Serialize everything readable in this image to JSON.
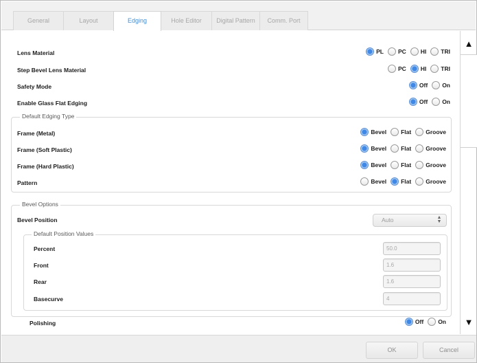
{
  "tabs": [
    {
      "label": "General"
    },
    {
      "label": "Layout"
    },
    {
      "label": "Edging"
    },
    {
      "label": "Hole Editor"
    },
    {
      "label": "Digital Pattern"
    },
    {
      "label": "Comm. Port"
    }
  ],
  "active_tab": "Edging",
  "settings": {
    "lens_material": {
      "label": "Lens Material",
      "options": [
        "PL",
        "PC",
        "HI",
        "TRI"
      ],
      "selected": "PL"
    },
    "step_bevel": {
      "label": "Step Bevel Lens Material",
      "options": [
        "PC",
        "HI",
        "TRI"
      ],
      "selected": "HI"
    },
    "safety_mode": {
      "label": "Safety Mode",
      "options": [
        "Off",
        "On"
      ],
      "selected": "Off"
    },
    "glass_flat": {
      "label": "Enable Glass Flat Edging",
      "options": [
        "Off",
        "On"
      ],
      "selected": "Off"
    }
  },
  "default_edging": {
    "legend": "Default Edging Type",
    "options": [
      "Bevel",
      "Flat",
      "Groove"
    ],
    "rows": [
      {
        "label": "Frame (Metal)",
        "selected": "Bevel"
      },
      {
        "label": "Frame (Soft Plastic)",
        "selected": "Bevel"
      },
      {
        "label": "Frame (Hard Plastic)",
        "selected": "Bevel"
      },
      {
        "label": "Pattern",
        "selected": "Flat"
      }
    ]
  },
  "bevel_options": {
    "legend": "Bevel Options",
    "bevel_position": {
      "label": "Bevel Position",
      "value": "Auto"
    },
    "default_position": {
      "legend": "Default Position Values",
      "fields": [
        {
          "label": "Percent",
          "value": "50.0"
        },
        {
          "label": "Front",
          "value": "1.6"
        },
        {
          "label": "Rear",
          "value": "1.6"
        },
        {
          "label": "Basecurve",
          "value": "4"
        }
      ]
    }
  },
  "polishing": {
    "label": "Polishing",
    "options": [
      "Off",
      "On"
    ],
    "selected": "Off"
  },
  "footer": {
    "ok": "OK",
    "cancel": "Cancel"
  },
  "colors": {
    "accent": "#3d8fd6",
    "radio_selected": "#3f88e6"
  }
}
